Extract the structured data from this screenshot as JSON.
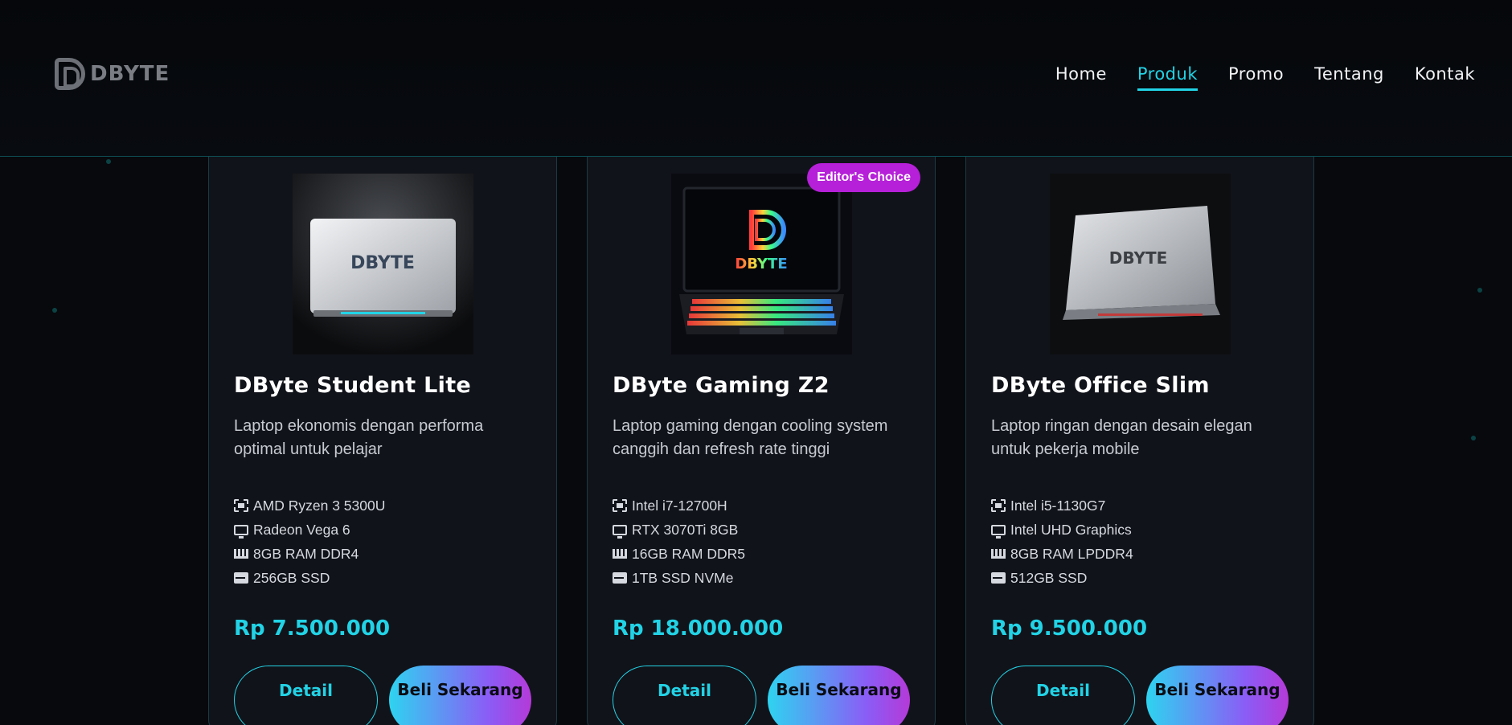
{
  "brand": {
    "name": "DBYTE"
  },
  "nav": [
    {
      "label": "Home",
      "active": false
    },
    {
      "label": "Produk",
      "active": true
    },
    {
      "label": "Promo",
      "active": false
    },
    {
      "label": "Tentang",
      "active": false
    },
    {
      "label": "Kontak",
      "active": false
    }
  ],
  "colors": {
    "accent": "#22d3e6",
    "badge": "#b520d8",
    "card_bg": "#11131a"
  },
  "products": [
    {
      "title": "DByte Student Lite",
      "desc": "Laptop ekonomis dengan performa optimal untuk pelajar",
      "specs": [
        "AMD Ryzen 3 5300U",
        "Radeon Vega 6",
        "8GB RAM DDR4",
        "256GB SSD"
      ],
      "price": "Rp 7.500.000",
      "detail_label": "Detail",
      "buy_label": "Beli Sekarang",
      "image_label": "DBYTE"
    },
    {
      "title": "DByte Gaming Z2",
      "desc": "Laptop gaming dengan cooling system canggih dan refresh rate tinggi",
      "badge": "Editor's Choice",
      "specs": [
        "Intel i7-12700H",
        "RTX 3070Ti 8GB",
        "16GB RAM DDR5",
        "1TB SSD NVMe"
      ],
      "price": "Rp 18.000.000",
      "detail_label": "Detail",
      "buy_label": "Beli Sekarang",
      "image_label": "DBYTE"
    },
    {
      "title": "DByte Office Slim",
      "desc": "Laptop ringan dengan desain elegan untuk pekerja mobile",
      "specs": [
        "Intel i5-1130G7",
        "Intel UHD Graphics",
        "8GB RAM LPDDR4",
        "512GB SSD"
      ],
      "price": "Rp 9.500.000",
      "detail_label": "Detail",
      "buy_label": "Beli Sekarang",
      "image_label": "DBYTE"
    }
  ]
}
